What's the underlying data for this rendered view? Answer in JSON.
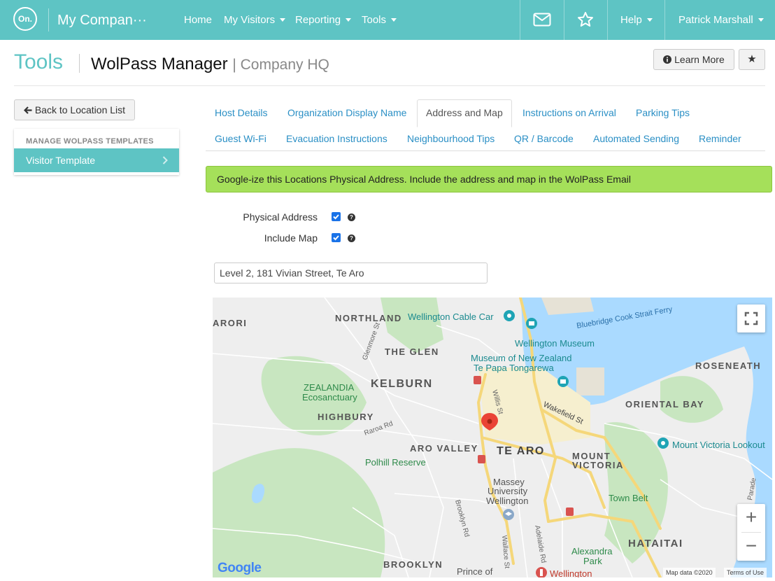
{
  "navbar": {
    "logo_text": "On.",
    "brand": "My Compan···",
    "items": [
      {
        "label": "Home",
        "dropdown": false
      },
      {
        "label": "My Visitors",
        "dropdown": true
      },
      {
        "label": "Reporting",
        "dropdown": true
      },
      {
        "label": "Tools",
        "dropdown": true
      }
    ],
    "mail_icon": "envelope-icon",
    "star_icon": "star-icon",
    "help": {
      "label": "Help",
      "dropdown": true
    },
    "user": {
      "label": "Patrick Marshall",
      "dropdown": true
    }
  },
  "header": {
    "title": "Tools",
    "subtitle": "WolPass Manager",
    "location": "| Company HQ",
    "learn_more": "Learn More",
    "learn_more_icon": "info-icon",
    "favorite_label": "★"
  },
  "sidebar": {
    "back_button": "Back to Location List",
    "back_icon": "arrow-left-icon",
    "section_heading": "MANAGE WOLPASS TEMPLATES",
    "items": [
      {
        "label": "Visitor Template",
        "selected": true
      }
    ]
  },
  "tabs": {
    "row1": [
      "Host Details",
      "Organization Display Name",
      "Address and Map",
      "Instructions on Arrival",
      "Parking Tips"
    ],
    "row2": [
      "Guest Wi-Fi",
      "Evacuation Instructions",
      "Neighbourhood Tips",
      "QR / Barcode",
      "Automated Sending",
      "Reminder"
    ],
    "active": "Address and Map"
  },
  "alert": {
    "text": "Google-ize this Locations Physical Address. Include the address and map in the WolPass Email"
  },
  "form": {
    "physical_address": {
      "label": "Physical Address",
      "checked": true,
      "help": "?"
    },
    "include_map": {
      "label": "Include Map",
      "checked": true,
      "help": "?"
    },
    "address_value": "Level 2, 181 Vivian Street, Te Aro"
  },
  "map": {
    "labels": [
      "ARORI",
      "NORTHLAND",
      "Wellington Cable Car",
      "Bluebridge Cook Strait Ferry",
      "THE GLEN",
      "Wellington Museum",
      "Museum of New Zealand",
      "Te Papa Tongarewa",
      "ROSENEATH",
      "ZEALANDIA",
      "Ecosanctuary",
      "KELBURN",
      "Wakefield St",
      "ORIENTAL BAY",
      "HIGHBURY",
      "Raroa Rd",
      "ARO VALLEY",
      "TE ARO",
      "MOUNT",
      "VICTORIA",
      "Mount Victoria Lookout",
      "Polhill Reserve",
      "Massey",
      "University",
      "Wellington",
      "Town Belt",
      "Brooklyn Rd",
      "Wallace St",
      "Adelaide Rd",
      "Alexandra",
      "Park",
      "HATAITAI",
      "BROOKLYN",
      "Prince of",
      "Wellington",
      "Glenmore St",
      "Willis St",
      "Parade"
    ],
    "google_logo": "Google",
    "attribution": "Map data ©2020",
    "terms": "Terms of Use",
    "fullscreen_icon": "fullscreen-icon",
    "zoom_in": "+",
    "zoom_out": "−",
    "water_color": "#aadaff",
    "park_color": "#c8e6c0"
  },
  "colors": {
    "brand": "#5ec4c4",
    "link": "#2a8fc5",
    "alert": "#a5e05a"
  }
}
